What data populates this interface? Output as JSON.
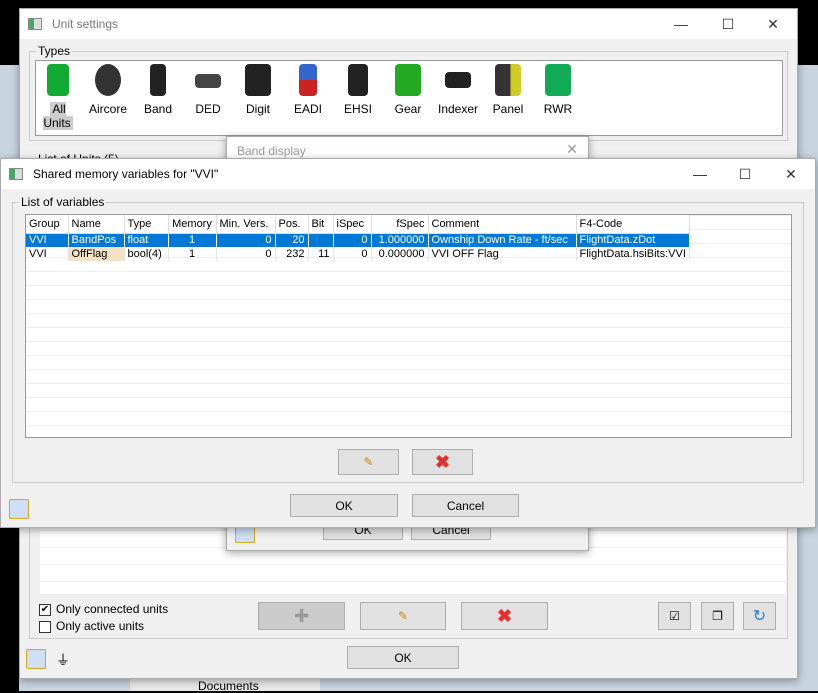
{
  "unit_settings": {
    "title": "Unit settings",
    "types_label": "Types",
    "types": [
      "All Units",
      "Aircore",
      "Band",
      "DED",
      "Digit",
      "EADI",
      "EHSI",
      "Gear",
      "Indexer",
      "Panel",
      "RWR"
    ],
    "list_label": "List of Units (5)",
    "only_connected": "Only connected units",
    "only_connected_checked": true,
    "only_active": "Only active units",
    "only_active_checked": false,
    "ok": "OK"
  },
  "band_display": {
    "title": "Band display",
    "ok": "OK",
    "cancel": "Cancel"
  },
  "shm": {
    "title": "Shared memory variables for \"VVI\"",
    "group_label": "List of variables",
    "columns": [
      "Group",
      "Name",
      "Type",
      "Memory",
      "Min. Vers.",
      "Pos.",
      "Bit",
      "iSpec",
      "fSpec",
      "Comment",
      "F4-Code"
    ],
    "rows": [
      [
        "VVI",
        "BandPos",
        "float",
        "1",
        "0",
        "20",
        "",
        "0",
        "1.000000",
        "Ownship Down Rate - ft/sec",
        "FlightData.zDot"
      ],
      [
        "VVI",
        "OffFlag",
        "bool(4)",
        "1",
        "0",
        "232",
        "11",
        "0",
        "0.000000",
        "VVI OFF Flag",
        "FlightData.hsiBits:VVI"
      ]
    ],
    "selected_row": 0,
    "ok": "OK",
    "cancel": "Cancel"
  },
  "desktop": {
    "documents": "Documents"
  },
  "colors": {
    "selection": "#0078d7",
    "delete": "#e03030"
  }
}
